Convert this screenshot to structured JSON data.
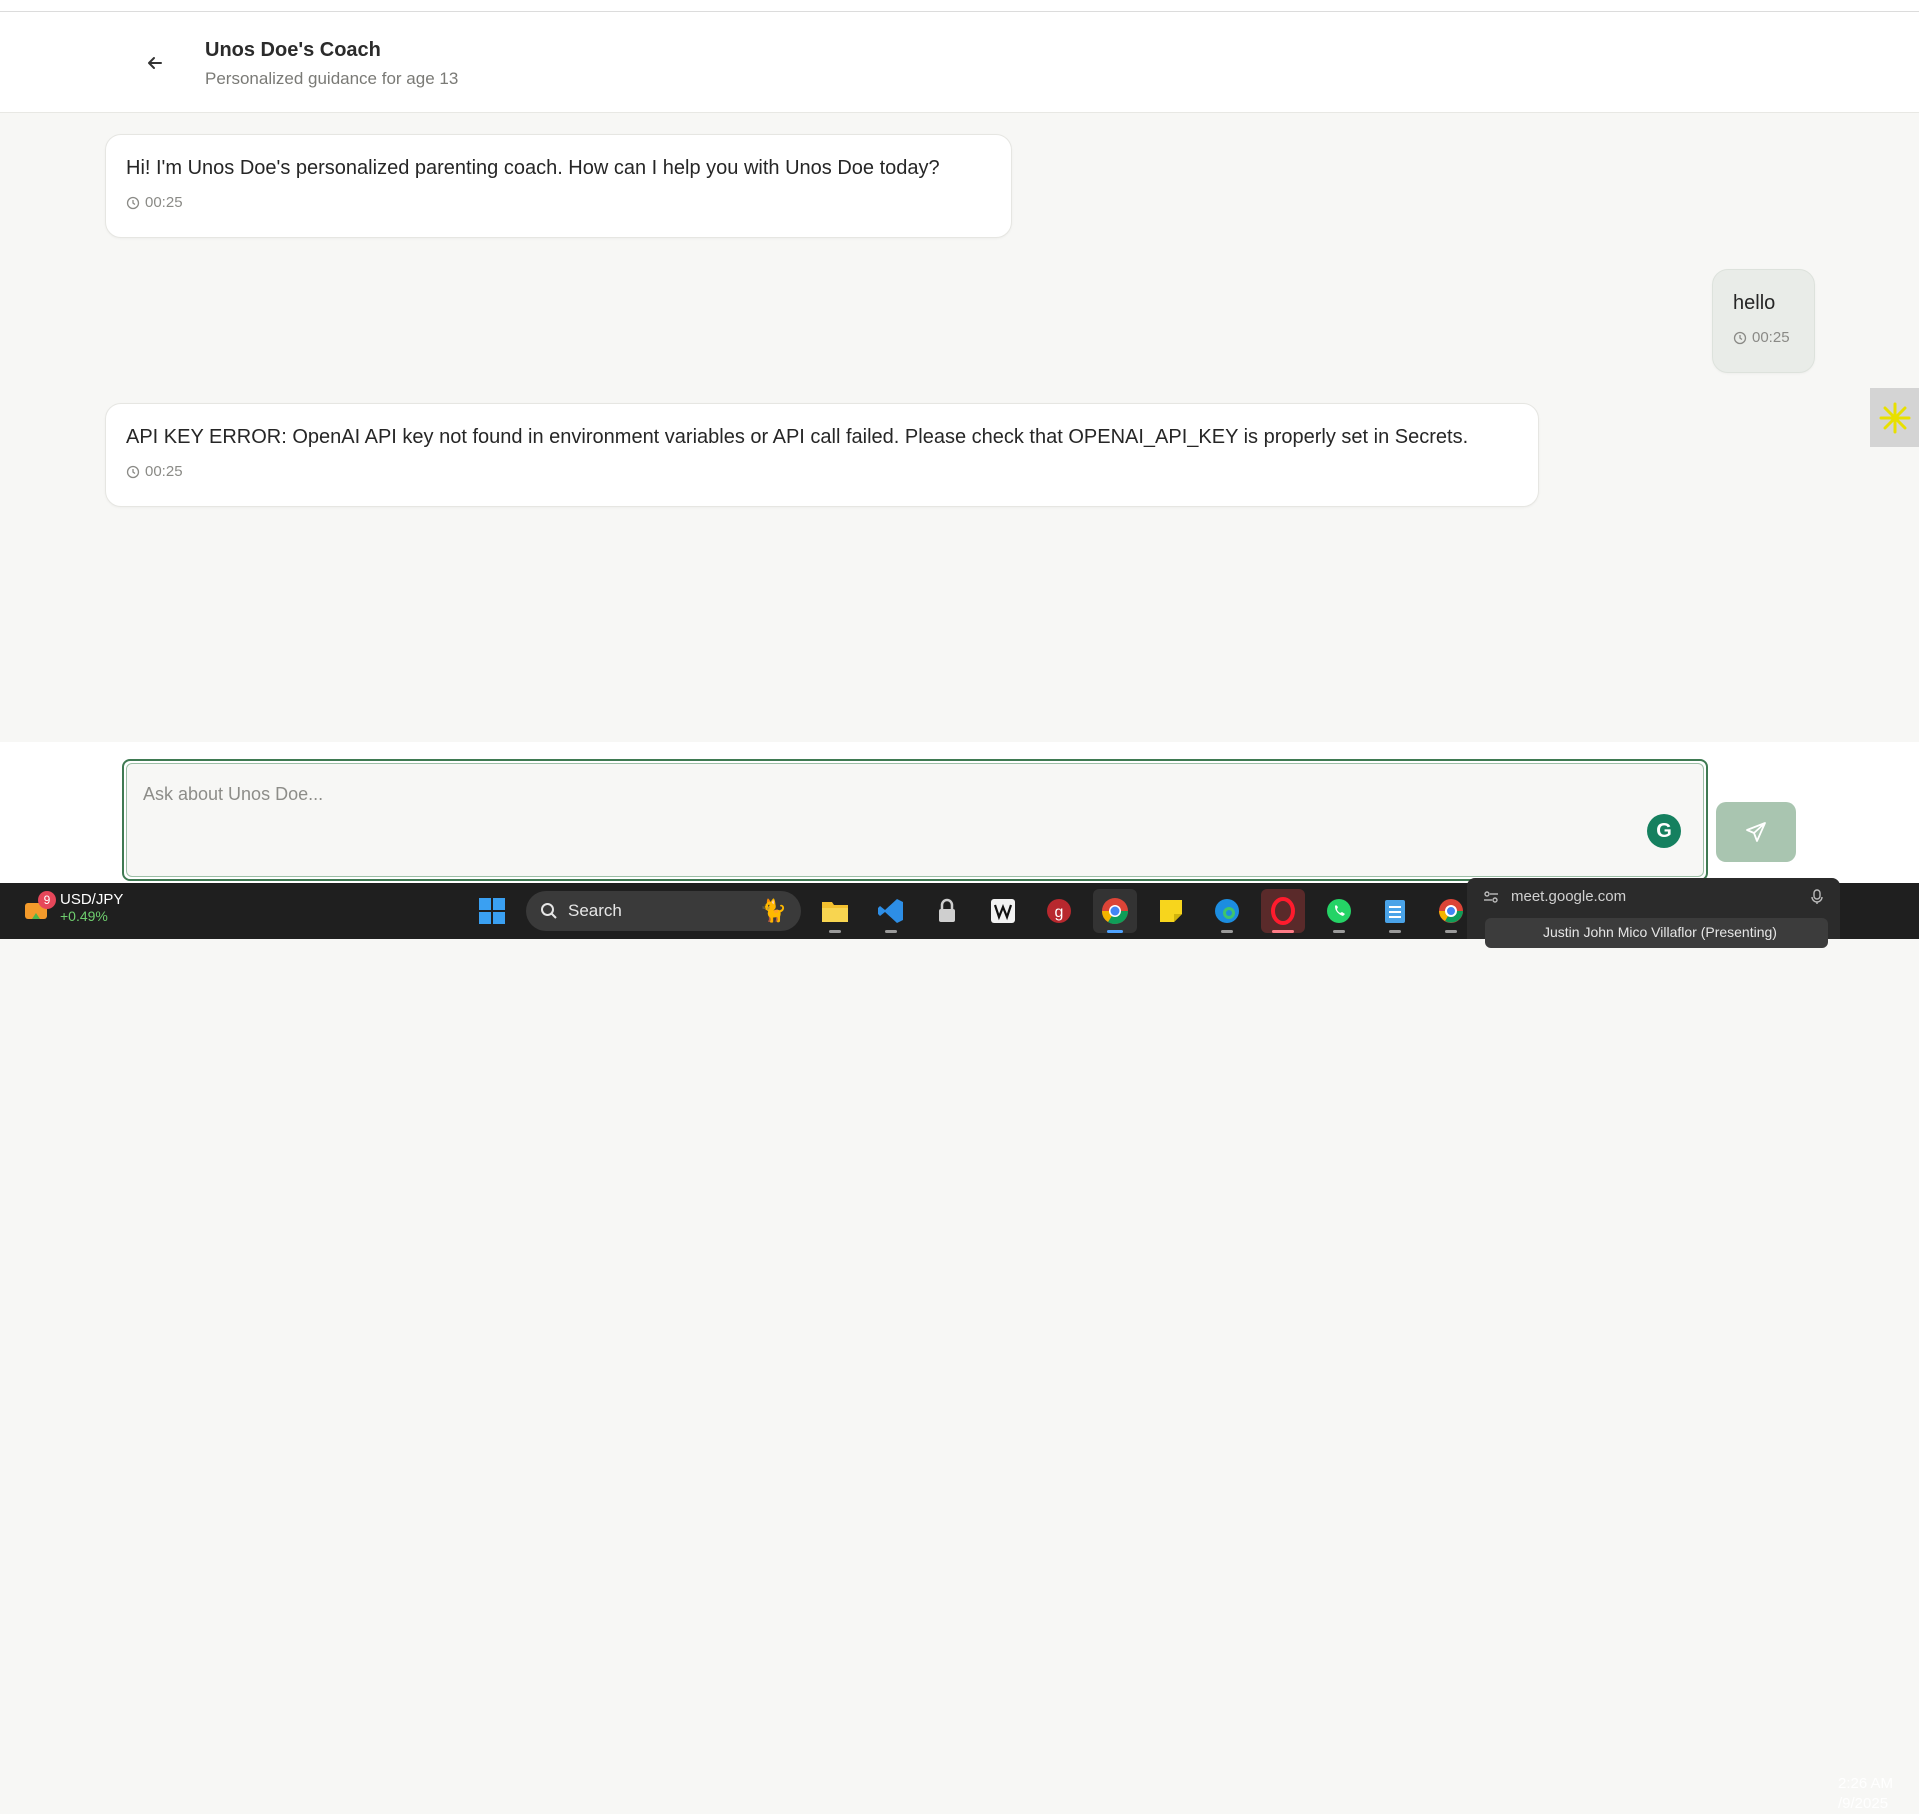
{
  "header": {
    "title": "Unos Doe's Coach",
    "subtitle": "Personalized guidance for age 13"
  },
  "messages": [
    {
      "role": "assistant",
      "text": "Hi! I'm Unos Doe's personalized parenting coach. How can I help you with Unos Doe today?",
      "time": "00:25"
    },
    {
      "role": "user",
      "text": "hello",
      "time": "00:25"
    },
    {
      "role": "assistant",
      "text": "API KEY ERROR: OpenAI API key not found in environment variables or API call failed. Please check that OPENAI_API_KEY is properly set in Secrets.",
      "time": "00:25"
    }
  ],
  "composer": {
    "placeholder": "Ask about Unos Doe...",
    "value": ""
  },
  "colors": {
    "accent_green": "#3f7a52",
    "send_button": "#a9c5b0",
    "user_bubble": "#e9ece8"
  },
  "taskbar": {
    "ticker": {
      "badge": "9",
      "symbol": "USD/JPY",
      "change": "+0.49%"
    },
    "search_label": "Search",
    "meet": {
      "url": "meet.google.com",
      "presenter": "Justin John Mico Villaflor (Presenting)"
    },
    "clock": {
      "time": "2:26 AM",
      "date": "/9/2025"
    }
  }
}
